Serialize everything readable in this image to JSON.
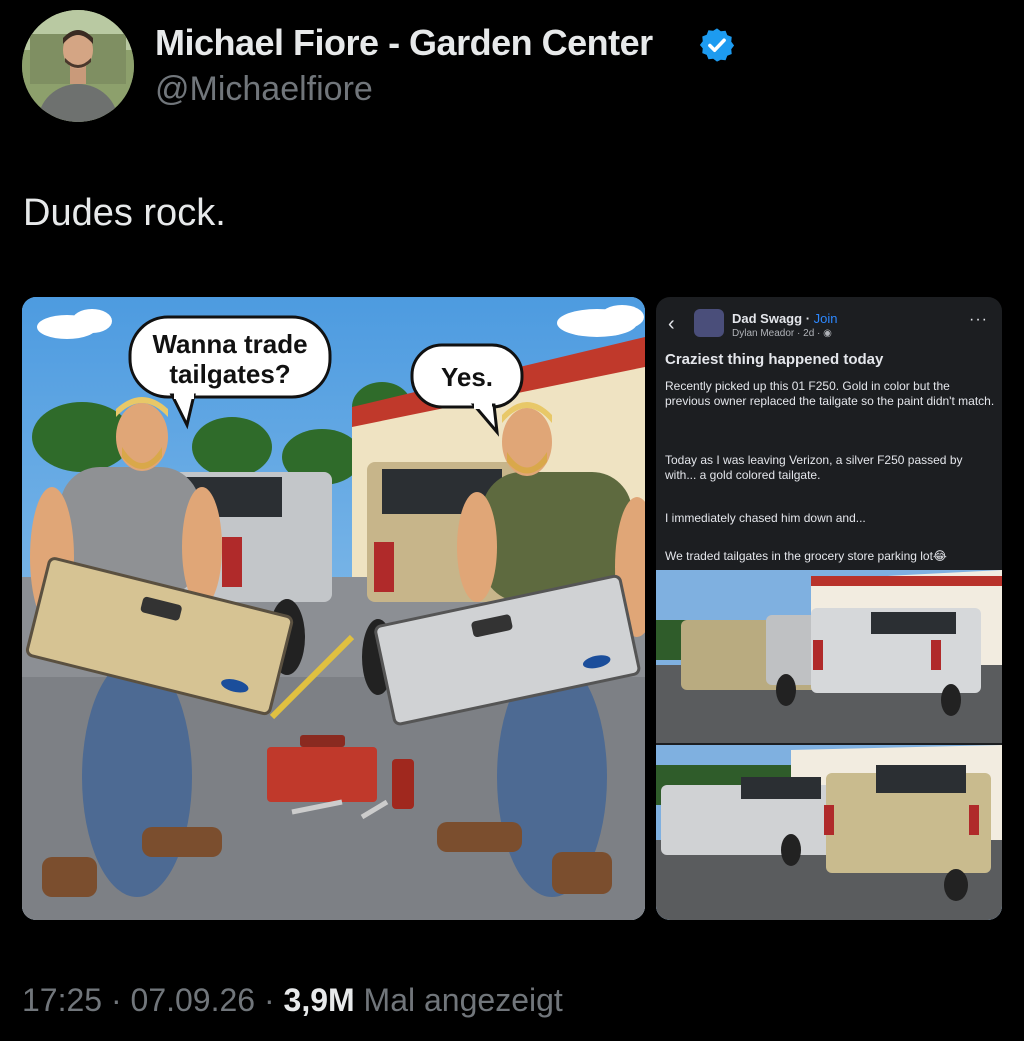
{
  "author": {
    "name": "Michael Fiore - Garden Center",
    "handle": "@Michaelfiore",
    "verified": true,
    "avatar_icon": "profile-photo"
  },
  "tweet": {
    "text": "Dudes rock."
  },
  "media_left": {
    "bubble_left_line1": "Wanna trade",
    "bubble_left_line2": "tailgates?",
    "bubble_right": "Yes."
  },
  "media_right": {
    "group": "Dad Swagg",
    "join": "Join",
    "author": "Dylan Meador",
    "age": "2d",
    "title": "Craziest thing happened today",
    "p1": "Recently picked up this 01 F250. Gold in color but the previous owner replaced the tailgate so the paint didn't match.",
    "p2": "Today as I was leaving Verizon, a silver F250 passed by with... a gold colored tailgate.",
    "p3": "I immediately chased him down and...",
    "p4": "We traded tailgates in the grocery store parking lot😂"
  },
  "footer": {
    "time": "17:25",
    "date": "07.09.26",
    "views": "3,9M",
    "views_label": "Mal angezeigt"
  },
  "colors": {
    "background": "#000000",
    "text": "#e7e9ea",
    "muted": "#71767b",
    "verified": "#1d9bf0",
    "fb_link": "#2d88ff"
  }
}
